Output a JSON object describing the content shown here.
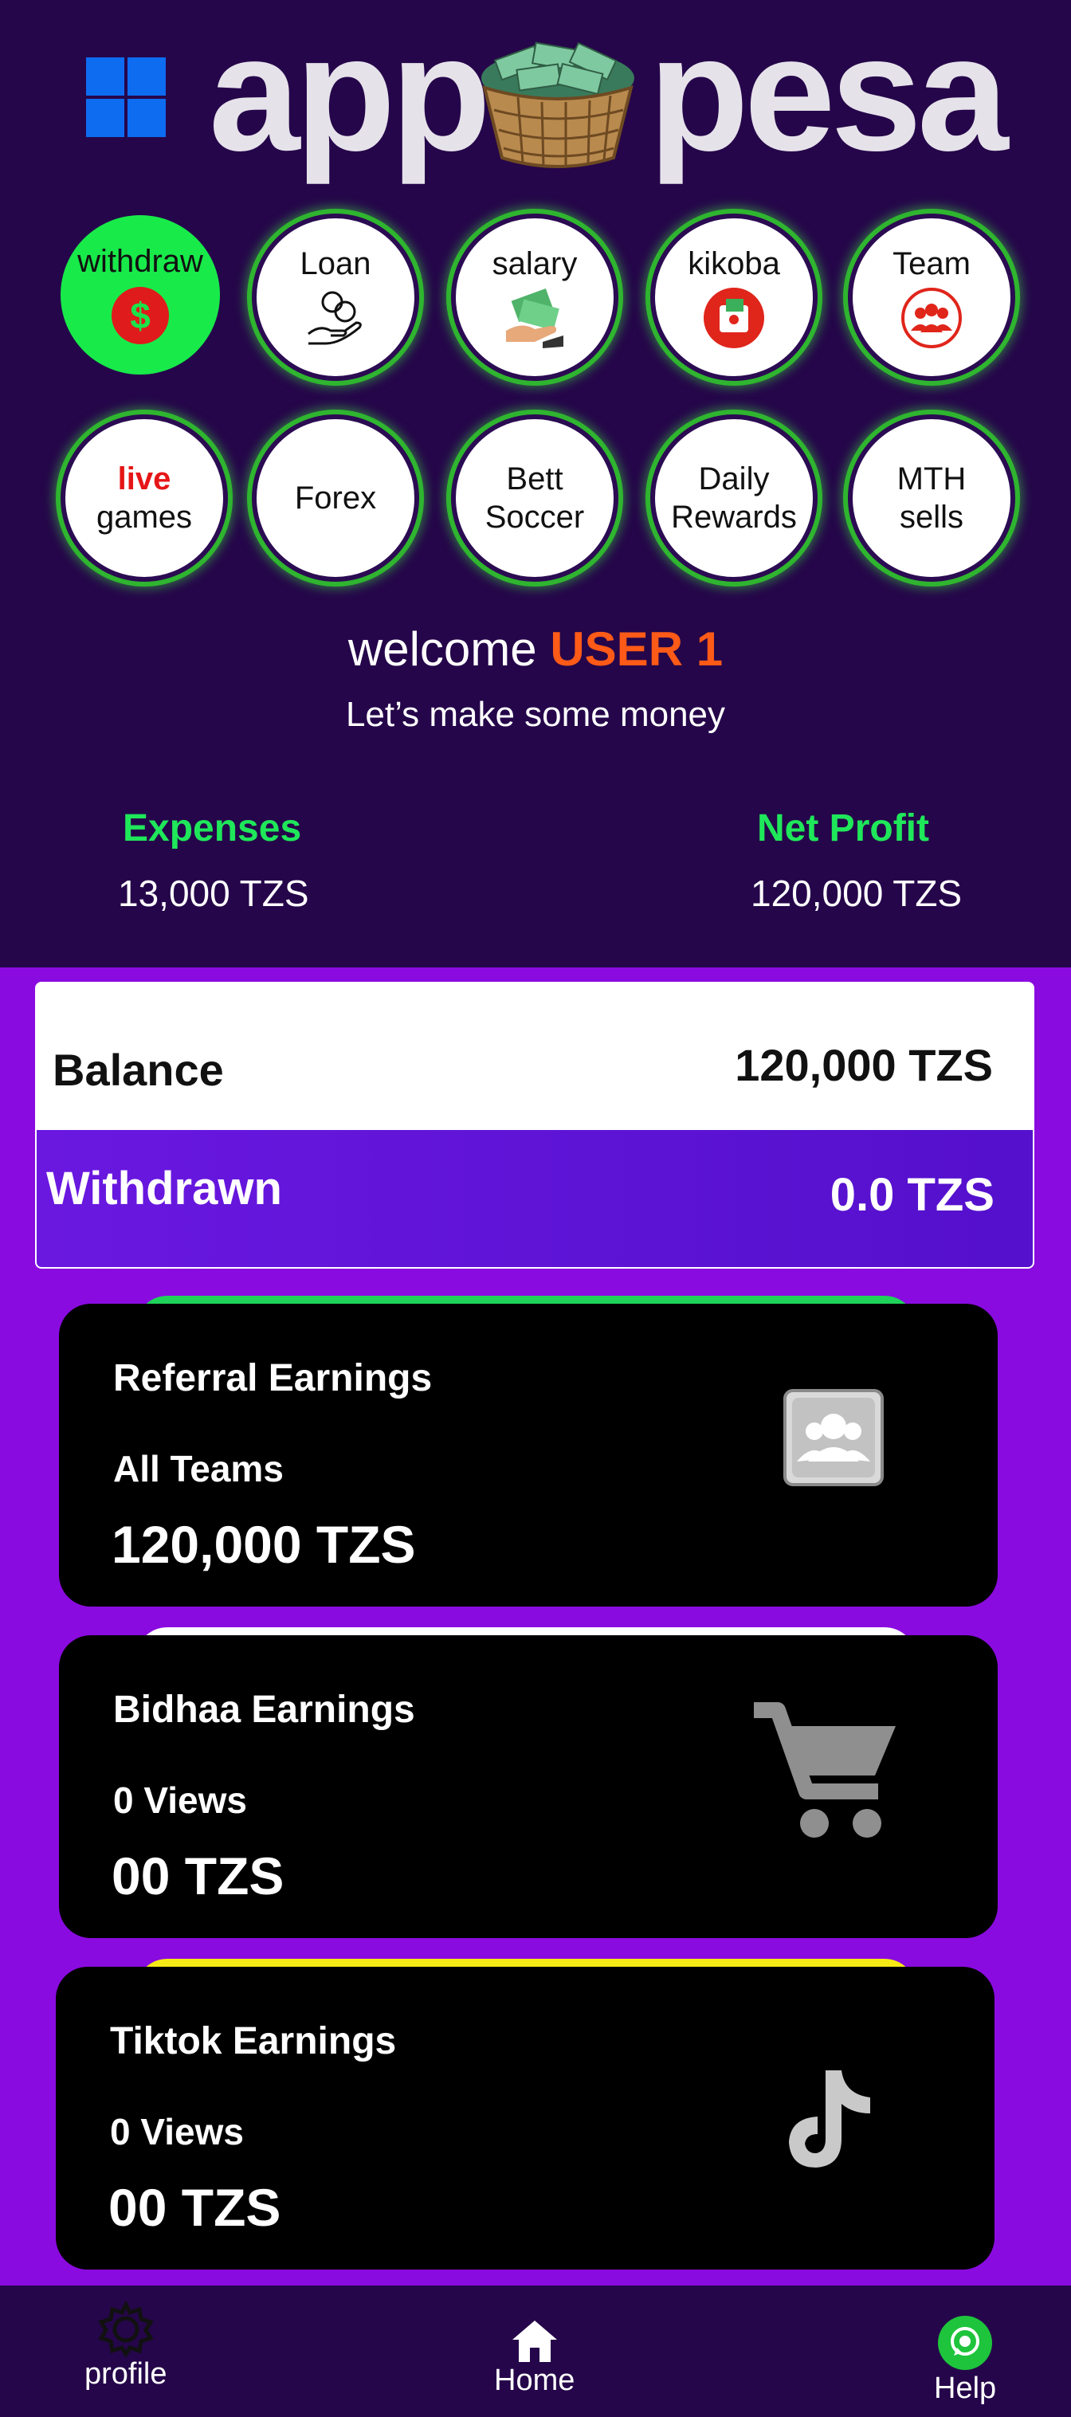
{
  "app": {
    "name": "app pesa"
  },
  "header": {
    "logo_word_left": "app",
    "logo_word_right": "pesa",
    "menu_row1": [
      {
        "label": "withdraw",
        "icon": "dollar-icon"
      },
      {
        "label": "Loan",
        "icon": "hand-coins-icon"
      },
      {
        "label": "salary",
        "icon": "money-hand-icon"
      },
      {
        "label": "kikoba",
        "icon": "wallet-icon"
      },
      {
        "label": "Team",
        "icon": "team-icon"
      }
    ],
    "menu_row2": [
      {
        "label_red": "live",
        "label": "games"
      },
      {
        "label": "Forex"
      },
      {
        "label": "Bett",
        "label2": "Soccer"
      },
      {
        "label": "Daily",
        "label2": "Rewards"
      },
      {
        "label": "MTH",
        "label2": "sells"
      }
    ],
    "welcome_prefix": "welcome",
    "user_name": "USER 1",
    "subtitle": "Let’s make some money",
    "expenses_label": "Expenses",
    "expenses_value": "13,000 TZS",
    "profit_label": "Net Profit",
    "profit_value": "120,000 TZS"
  },
  "balance": {
    "balance_label": "Balance",
    "balance_value": "120,000 TZS",
    "withdrawn_label": "Withdrawn",
    "withdrawn_value": "0.0 TZS"
  },
  "earnings": [
    {
      "title": "Referral Earnings",
      "sub": "All Teams",
      "value": "120,000 TZS",
      "icon": "users-icon",
      "accent": "#1fd35a"
    },
    {
      "title": "Bidhaa Earnings",
      "sub": "0 Views",
      "value": "00 TZS",
      "icon": "cart-icon",
      "accent": "#ffffff"
    },
    {
      "title": "Tiktok Earnings",
      "sub": "0 Views",
      "value": "00 TZS",
      "icon": "tiktok-icon",
      "accent": "#f5ea16"
    }
  ],
  "nav": {
    "profile": "profile",
    "home": "Home",
    "help": "Help"
  },
  "colors": {
    "header_bg": "#25064a",
    "page_bg": "#8a0be0",
    "accent_green": "#1fe75a",
    "user_orange": "#ff5a17"
  }
}
